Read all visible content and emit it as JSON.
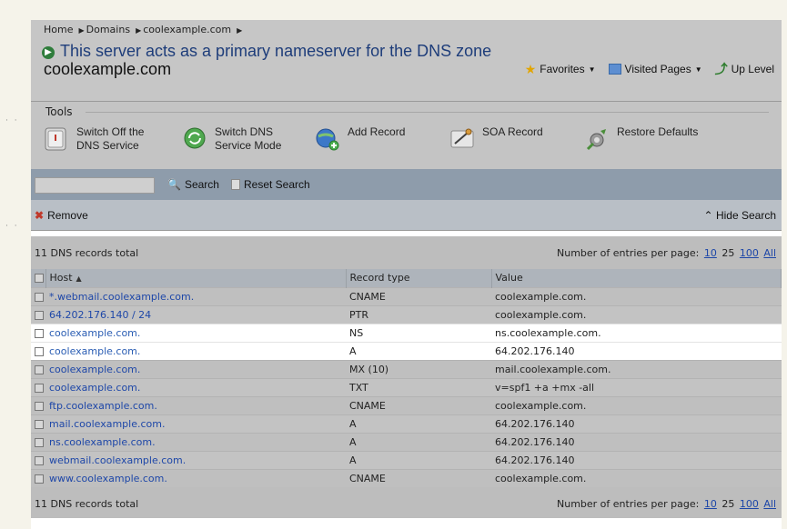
{
  "breadcrumb": [
    "Home",
    "Domains",
    "coolexample.com"
  ],
  "page": {
    "title": "This server acts as a primary nameserver for the DNS zone",
    "subtitle": "coolexample.com"
  },
  "header_actions": {
    "favorites": "Favorites",
    "visited": "Visited Pages",
    "up": "Up Level"
  },
  "tools": {
    "label": "Tools",
    "items": [
      {
        "label": "Switch Off the DNS Service",
        "line1": "Switch Off the",
        "line2": "DNS Service",
        "icon": "power-icon"
      },
      {
        "label": "Switch DNS Service Mode",
        "line1": "Switch DNS",
        "line2": "Service Mode",
        "icon": "cycle-icon"
      },
      {
        "label": "Add Record",
        "line1": "Add Record",
        "line2": "",
        "icon": "globe-add-icon"
      },
      {
        "label": "SOA Record",
        "line1": "SOA Record",
        "line2": "",
        "icon": "soa-icon"
      },
      {
        "label": "Restore Defaults",
        "line1": "Restore Defaults",
        "line2": "",
        "icon": "restore-icon"
      }
    ]
  },
  "search": {
    "value": "",
    "search_label": "Search",
    "reset_label": "Reset Search"
  },
  "actions": {
    "remove_label": "Remove",
    "hide_search_label": "Hide Search"
  },
  "totals": {
    "text": "11 DNS records total",
    "per_page_label": "Number of entries per page:",
    "options": [
      "10",
      "25",
      "100",
      "All"
    ],
    "current": "25"
  },
  "table": {
    "columns": [
      "Host",
      "Record type",
      "Value"
    ],
    "rows": [
      {
        "host": "*.webmail.coolexample.com.",
        "type": "CNAME",
        "value": "coolexample.com."
      },
      {
        "host": "64.202.176.140 / 24",
        "type": "PTR",
        "value": "coolexample.com."
      },
      {
        "host": "coolexample.com.",
        "type": "NS",
        "value": "ns.coolexample.com."
      },
      {
        "host": "coolexample.com.",
        "type": "A",
        "value": "64.202.176.140"
      },
      {
        "host": "coolexample.com.",
        "type": "MX (10)",
        "value": "mail.coolexample.com."
      },
      {
        "host": "coolexample.com.",
        "type": "TXT",
        "value": "v=spf1 +a +mx -all"
      },
      {
        "host": "ftp.coolexample.com.",
        "type": "CNAME",
        "value": "coolexample.com."
      },
      {
        "host": "mail.coolexample.com.",
        "type": "A",
        "value": "64.202.176.140"
      },
      {
        "host": "ns.coolexample.com.",
        "type": "A",
        "value": "64.202.176.140"
      },
      {
        "host": "webmail.coolexample.com.",
        "type": "A",
        "value": "64.202.176.140"
      },
      {
        "host": "www.coolexample.com.",
        "type": "CNAME",
        "value": "coolexample.com."
      }
    ]
  },
  "colors": {
    "link": "#1e47a8",
    "title": "#1e3d7a",
    "highlight_row": "#ffffff",
    "search_bar": "#8e9cab"
  }
}
